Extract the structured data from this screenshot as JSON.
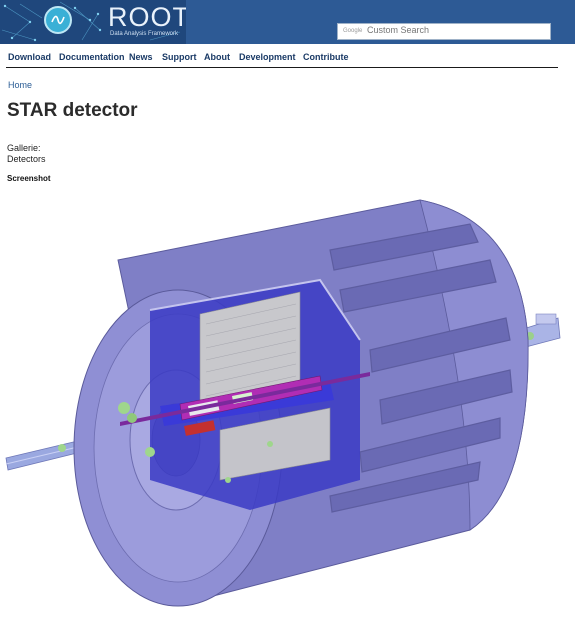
{
  "site": {
    "logo_text": "ROOT",
    "logo_subtitle": "Data Analysis Framework"
  },
  "search": {
    "powered_by": "Google",
    "label": "Custom Search"
  },
  "nav": {
    "items": [
      {
        "label": "Download"
      },
      {
        "label": "Documentation"
      },
      {
        "label": "News"
      },
      {
        "label": "Support"
      },
      {
        "label": "About"
      },
      {
        "label": "Development"
      },
      {
        "label": "Contribute"
      }
    ]
  },
  "breadcrumb": "Home",
  "page": {
    "title": "STAR detector",
    "gallery_label": "Gallerie:",
    "gallery_value": "Detectors",
    "screenshot_label": "Screenshot"
  },
  "colors": {
    "header_bg": "#2d5a95",
    "nav_text": "#1a3a66",
    "detector_body": "#8a8ad0"
  }
}
